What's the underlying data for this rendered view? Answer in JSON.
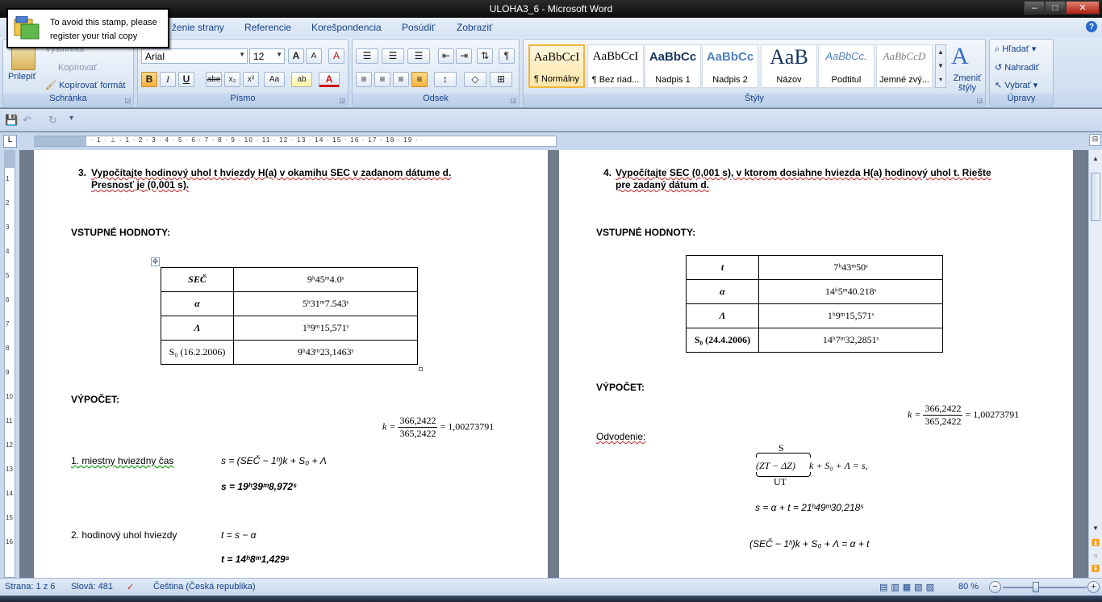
{
  "window": {
    "title": "ULOHA3_6 - Microsoft Word",
    "minimize": "–",
    "maximize": "□",
    "close": "✕"
  },
  "stamp": {
    "line1": "To avoid this stamp, please",
    "line2": "register your trial copy"
  },
  "tabs": [
    {
      "label": "ženie strany"
    },
    {
      "label": "Referencie"
    },
    {
      "label": "Korešpondencia"
    },
    {
      "label": "Posúdiť"
    },
    {
      "label": "Zobraziť"
    }
  ],
  "help": "?",
  "clipboard": {
    "paste": "Prilepiť",
    "cut": "Vystrihnúť",
    "copy": "Kopírovať",
    "format_painter": "Kopírovať formát",
    "label": "Schránka"
  },
  "font": {
    "name": "Arial",
    "size": "12",
    "label": "Písmo",
    "grow": "A",
    "shrink": "A",
    "clear": "A",
    "bold": "B",
    "italic": "I",
    "underline": "U",
    "strike": "abe",
    "sub": "x₂",
    "sup": "x²",
    "case": "Aa",
    "highlight": "ab",
    "color": "A"
  },
  "paragraph": {
    "label": "Odsek"
  },
  "styles": {
    "label": "Štýly",
    "items": [
      {
        "sample": "AaBbCcI",
        "name": "¶ Normálny"
      },
      {
        "sample": "AaBbCcI",
        "name": "¶ Bez riad..."
      },
      {
        "sample": "AaBbCc",
        "name": "Nadpis 1"
      },
      {
        "sample": "AaBbCc",
        "name": "Nadpis 2"
      },
      {
        "sample": "AaB",
        "name": "Názov"
      },
      {
        "sample": "AaBbCc.",
        "name": "Podtitul"
      },
      {
        "sample": "AaBbCcD",
        "name": "Jemné zvý..."
      }
    ],
    "change": "Zmeniť štýly"
  },
  "editing": {
    "find": "Hľadať",
    "replace": "Nahradiť",
    "select": "Vybrať",
    "label": "Úpravy"
  },
  "ruler": {
    "track": "· 1 · ⊥ · 1 · 2 · 3 · 4 · 5 · 6 · 7 · 8 · 9 · 10 · 11 · 12 · 13 · 14 · 15 · 16 · 17 · 18 · 19 ·",
    "tab_selector": "L"
  },
  "vruler": [
    "1",
    "2",
    "3",
    "4",
    "5",
    "6",
    "7",
    "8",
    "9",
    "10",
    "11",
    "12",
    "13",
    "14",
    "15",
    "16"
  ],
  "page_left": {
    "task_num": "3.",
    "task_line1": "Vypočítajte hodinový uhol t hviezdy H(a) v okamihu SEC v zadanom dátume d.",
    "task_line2": "Presnosť je (0,001 s).",
    "inputs_heading": "VSTUPNÉ HODNOTY:",
    "table": [
      {
        "label": "SEČ",
        "value": "9ʰ45ᵐ4.0ˢ"
      },
      {
        "label": "α",
        "value": "5ʰ31ᵐ7.543ˢ"
      },
      {
        "label": "Λ",
        "value": "1ʰ9ᵐ15,571ˢ"
      },
      {
        "label": "S₀ (16.2.2006)",
        "value": "9ʰ43ᵐ23,1463ˢ"
      }
    ],
    "calc_heading": "VÝPOČET:",
    "k_prefix": "k =",
    "k_num": "366,2422",
    "k_den": "365,2422",
    "k_result": "= 1,00273791",
    "step1_label": "1. miestny hviezdny čas",
    "step1_formula": "s = (SEČ − 1ʰ)k + S₀ + Λ",
    "step1_result": "s = 19ʰ39ᵐ8,972ˢ",
    "step2_label": "2. hodinový uhol hviezdy",
    "step2_formula": "t = s − α",
    "step2_result": "t = 14ʰ8ᵐ1,429ˢ"
  },
  "page_right": {
    "task_num": "4.",
    "task_line1": "Vypočítajte SEC (0,001 s), v ktorom dosiahne hviezda H(a) hodinový uhol t. Riešte",
    "task_line2": "pre zadaný dátum d.",
    "inputs_heading": "VSTUPNÉ HODNOTY:",
    "table": [
      {
        "label": "t",
        "value": "7ʰ43ᵐ50ˢ"
      },
      {
        "label": "α",
        "value": "14ʰ5ᵐ40.218ˢ"
      },
      {
        "label": "Λ",
        "value": "1ʰ9ᵐ15,571ˢ"
      },
      {
        "label": "S₀ (24.4.2006)",
        "value": "14ʰ7ᵐ32,2851ˢ"
      }
    ],
    "calc_heading": "VÝPOČET:",
    "k_prefix": "k =",
    "k_num": "366,2422",
    "k_den": "365,2422",
    "k_result": "= 1,00273791",
    "derivation": "Odvodenie:",
    "brace_top": "S",
    "brace_mid": "(ZT − ΔZ)",
    "brace_rest": "k + S₀ + Λ = s,",
    "brace_bottom": "UT",
    "eq2": "s = α + t = 21ʰ49ᵐ30,218ˢ",
    "eq3": "(SEČ − 1ʰ)k + S₀ + Λ = α + t"
  },
  "status": {
    "page": "Strana: 1 z 6",
    "words": "Slová: 481",
    "language": "Čeština (Česká republika)",
    "zoom": "80 %",
    "zoom_minus": "−",
    "zoom_plus": "+"
  }
}
